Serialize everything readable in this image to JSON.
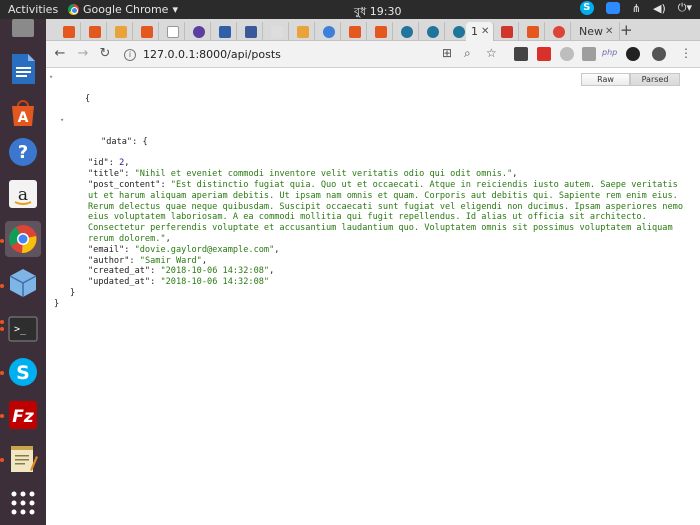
{
  "topbar": {
    "activities": "Activities",
    "app_name": "Google Chrome",
    "app_menu_arrow": "▾",
    "clock": "বুধ 19:30"
  },
  "browser": {
    "active_tab_label": "1",
    "newtab_label": "New",
    "close_glyph": "✕",
    "new_tab_glyph": "+",
    "url": "127.0.0.1:8000/api/posts"
  },
  "viewer": {
    "raw_label": "Raw",
    "parsed_label": "Parsed"
  },
  "json": {
    "open_brace": "{",
    "close_brace": "}",
    "data_key": "\"data\"",
    "id_key": "\"id\"",
    "id_value": "2",
    "title_key": "\"title\"",
    "title_value": "\"Nihil et eveniet commodi inventore velit veritatis odio qui odit omnis.\"",
    "post_content_key": "\"post_content\"",
    "post_content_value": "\"Est distinctio fugiat quia. Quo ut et occaecati. Atque in reiciendis iusto autem. Saepe veritatis ut et harum aliquam aperiam debitis. Ut ipsam nam omnis et quam. Corporis aut debitis qui. Sapiente rem enim eius. Rerum delectus quae neque quibusdam. Suscipit occaecati sunt fugiat vel eligendi non ducimus. Ipsam asperiores nemo eius voluptatem laboriosam. A ea commodi mollitia qui fugit repellendus. Id alias ut officia sit architecto. Consectetur perferendis voluptate et accusantium laudantium quo. Voluptatem omnis sit possimus voluptatem aliquam rerum dolorem.\"",
    "email_key": "\"email\"",
    "email_value": "\"dovie.gaylord@example.com\"",
    "author_key": "\"author\"",
    "author_value": "\"Samir Ward\"",
    "created_at_key": "\"created_at\"",
    "created_at_value": "\"2018-10-06 14:32:08\"",
    "updated_at_key": "\"updated_at\"",
    "updated_at_value": "\"2018-10-06 14:32:08\""
  },
  "colors": {
    "string": "#2a7a13",
    "number": "#1a1aa6",
    "launcher_bg": "#3c2f3a",
    "topbar_bg": "#2b2b2b"
  }
}
